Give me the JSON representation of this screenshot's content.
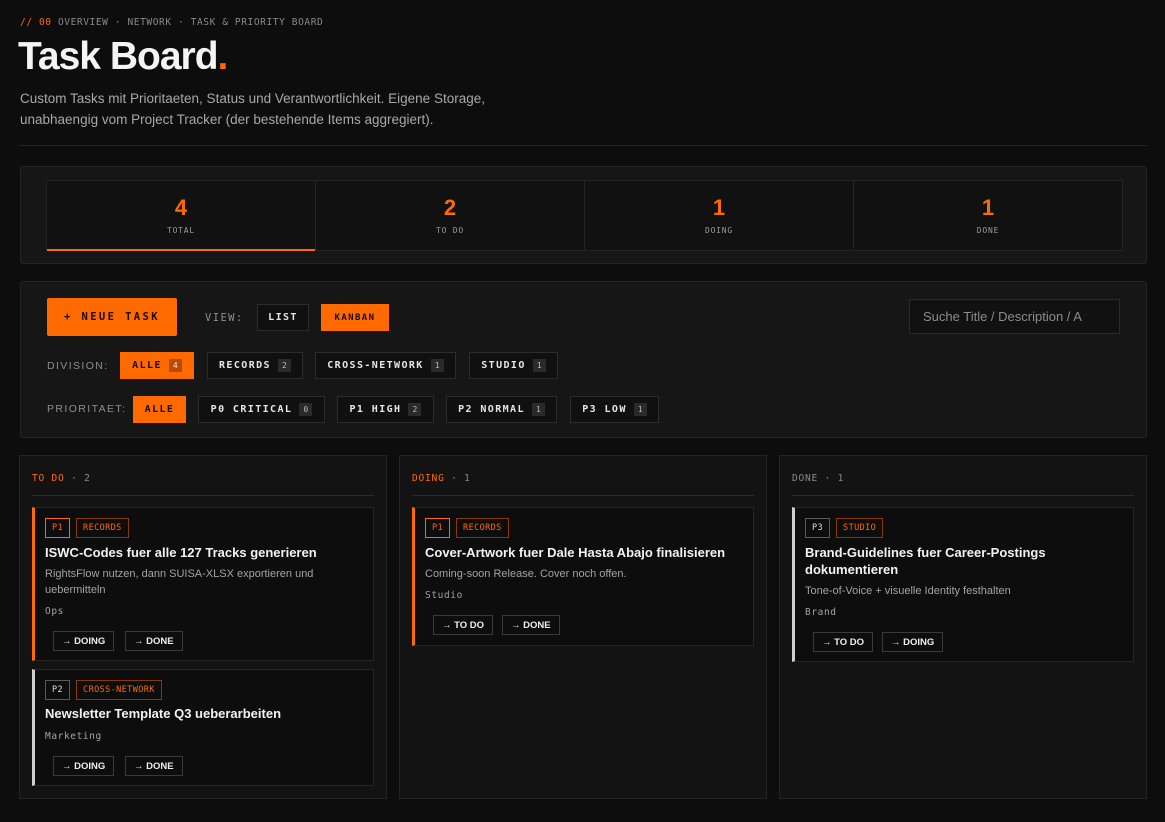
{
  "header": {
    "eyebrow_prefix": "// 00",
    "eyebrow_path": "OVERVIEW · NETWORK · TASK & PRIORITY BOARD",
    "title": "Task Board",
    "title_dot": ".",
    "subtitle": "Custom Tasks mit Prioritaeten, Status und Verantwortlichkeit. Eigene Storage, unabhaengig vom Project Tracker (der bestehende Items aggregiert)."
  },
  "stats": [
    {
      "value": "4",
      "label": "TOTAL",
      "active": true
    },
    {
      "value": "2",
      "label": "TO DO",
      "active": false
    },
    {
      "value": "1",
      "label": "DOING",
      "active": false
    },
    {
      "value": "1",
      "label": "DONE",
      "active": false
    }
  ],
  "toolbar": {
    "new_task_label": "+ NEUE TASK",
    "view_label": "VIEW:",
    "view_options": [
      {
        "label": "LIST",
        "active": false
      },
      {
        "label": "KANBAN",
        "active": true
      }
    ],
    "search_placeholder": "Suche Title / Description / A"
  },
  "division_filter": {
    "label": "DIVISION:",
    "options": [
      {
        "label": "ALLE",
        "count": "4",
        "active": true
      },
      {
        "label": "RECORDS",
        "count": "2",
        "active": false
      },
      {
        "label": "CROSS-NETWORK",
        "count": "1",
        "active": false
      },
      {
        "label": "STUDIO",
        "count": "1",
        "active": false
      }
    ]
  },
  "priority_filter": {
    "label": "PRIORITAET:",
    "options": [
      {
        "label": "ALLE",
        "count": null,
        "active": true
      },
      {
        "label": "P0 CRITICAL",
        "count": "0",
        "active": false
      },
      {
        "label": "P1 HIGH",
        "count": "2",
        "active": false
      },
      {
        "label": "P2 NORMAL",
        "count": "1",
        "active": false
      },
      {
        "label": "P3 LOW",
        "count": "1",
        "active": false
      }
    ]
  },
  "columns": [
    {
      "name": "TO DO",
      "count": "· 2",
      "tasks": [
        {
          "priority": "P1",
          "division": "RECORDS",
          "title": "ISWC-Codes fuer alle 127 Tracks generieren",
          "description": "RightsFlow nutzen, dann SUISA-XLSX exportieren und uebermitteln",
          "owner": "Ops",
          "actions": [
            "→ DOING",
            "→ DONE"
          ]
        },
        {
          "priority": "P2",
          "division": "CROSS-NETWORK",
          "title": "Newsletter Template Q3 ueberarbeiten",
          "description": "",
          "owner": "Marketing",
          "actions": [
            "→ DOING",
            "→ DONE"
          ]
        }
      ]
    },
    {
      "name": "DOING",
      "count": "· 1",
      "tasks": [
        {
          "priority": "P1",
          "division": "RECORDS",
          "title": "Cover-Artwork fuer Dale Hasta Abajo finalisieren",
          "description": "Coming-soon Release. Cover noch offen.",
          "owner": "Studio",
          "actions": [
            "→ TO DO",
            "→ DONE"
          ]
        }
      ]
    },
    {
      "name": "DONE",
      "count": "· 1",
      "tasks": [
        {
          "priority": "P3",
          "division": "STUDIO",
          "title": "Brand-Guidelines fuer Career-Postings dokumentieren",
          "description": "Tone-of-Voice + visuelle Identity festhalten",
          "owner": "Brand",
          "actions": [
            "→ TO DO",
            "→ DOING"
          ]
        }
      ]
    }
  ],
  "colors": {
    "accent": "#ff6a00",
    "background": "#0d0d0d",
    "panel": "#161616",
    "border": "#242424"
  }
}
